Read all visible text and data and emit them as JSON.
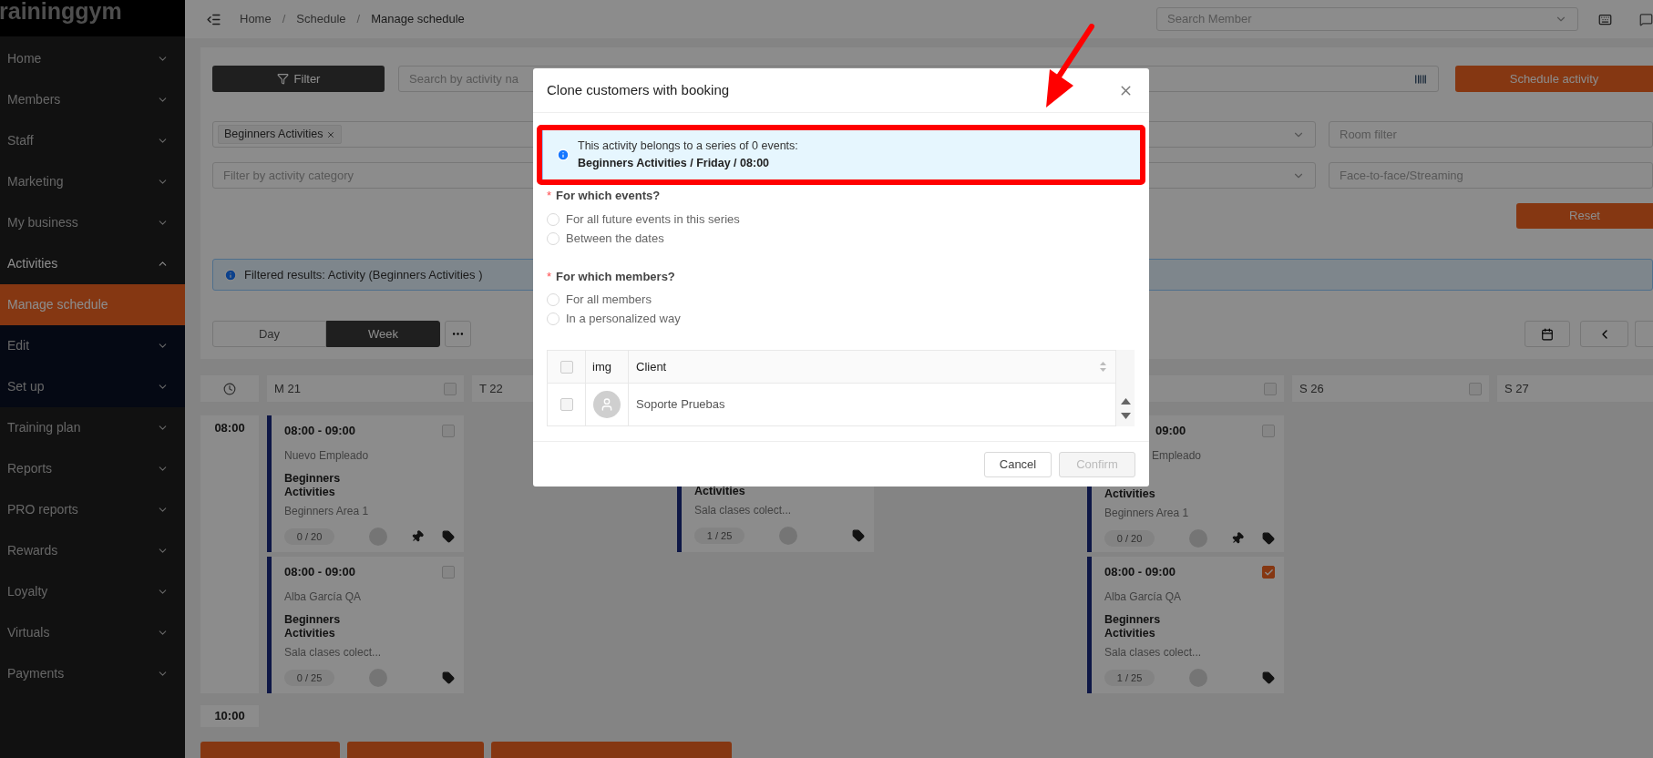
{
  "sidebar": {
    "logo": "raininggym",
    "items": [
      {
        "label": "Home",
        "selected": false,
        "expanded": false
      },
      {
        "label": "Members",
        "selected": false,
        "expanded": false
      },
      {
        "label": "Staff",
        "selected": false,
        "expanded": false
      },
      {
        "label": "Marketing",
        "selected": false,
        "expanded": false
      },
      {
        "label": "My business",
        "selected": false,
        "expanded": false
      },
      {
        "label": "Activities",
        "selected": false,
        "expanded": true,
        "children": [
          {
            "label": "Manage schedule",
            "selected": true
          },
          {
            "label": "Edit",
            "selected": false
          },
          {
            "label": "Set up",
            "selected": false
          }
        ]
      },
      {
        "label": "Training plan",
        "selected": false,
        "expanded": false
      },
      {
        "label": "Reports",
        "selected": false,
        "expanded": false
      },
      {
        "label": "PRO reports",
        "selected": false,
        "expanded": false
      },
      {
        "label": "Rewards",
        "selected": false,
        "expanded": false
      },
      {
        "label": "Loyalty",
        "selected": false,
        "expanded": false
      },
      {
        "label": "Virtuals",
        "selected": false,
        "expanded": false
      },
      {
        "label": "Payments",
        "selected": false,
        "expanded": false
      }
    ]
  },
  "breadcrumb": {
    "separator": "/",
    "items": [
      "Home",
      "Schedule",
      "Manage schedule"
    ]
  },
  "search_member": {
    "placeholder": "Search Member"
  },
  "filters": {
    "filter_button": "Filter",
    "search": {
      "placeholder": "Search by activity na"
    },
    "schedule_button": "Schedule activity",
    "activity_tags": [
      "Beginners Activities"
    ],
    "room": {
      "placeholder": "Room filter"
    },
    "category": {
      "placeholder": "Filter by activity category"
    },
    "mode": {
      "placeholder": "Face-to-face/Streaming"
    },
    "reset_button": "Reset"
  },
  "info_bar": "Filtered results: Activity (Beginners Activities )",
  "view_tabs": [
    {
      "label": "Day",
      "selected": false
    },
    {
      "label": "Week",
      "selected": true
    }
  ],
  "calendar": {
    "days": [
      {
        "kind": "day",
        "label": "M 21",
        "checked": false,
        "events": [
          {
            "kind": "full",
            "time": "08:00 - 09:00",
            "teacher": "Nuevo Empleado",
            "activity": "Beginners Activities",
            "room": "Beginners Area 1",
            "count": "0 / 20",
            "checked": false,
            "pinned": true
          },
          {
            "kind": "full",
            "time": "08:00 - 09:00",
            "teacher": "Alba García QA",
            "activity": "Beginners Activities",
            "room": "Sala clases colect...",
            "count": "0 / 25",
            "checked": false,
            "pinned": false
          }
        ]
      },
      {
        "kind": "day",
        "label": "T 22"
      },
      {
        "kind": "covered",
        "events": [
          {
            "kind": "cut_top",
            "activity": "Activities",
            "room": "Sala clases colect...",
            "count": "1 / 25",
            "pinned": false
          }
        ]
      },
      {
        "kind": "covered"
      },
      {
        "kind": "covered",
        "checked": false,
        "events": [
          {
            "kind": "cut_left",
            "time": "09:00",
            "teacher": "Empleado",
            "activity": "Activities",
            "room": "Beginners Area 1",
            "count": "0 / 20",
            "checked": false,
            "pinned": true
          },
          {
            "kind": "full",
            "time": "08:00 - 09:00",
            "teacher": "Alba García QA",
            "activity": "Beginners Activities",
            "room": "Sala clases colect...",
            "count": "1 / 25",
            "checked": true,
            "pinned": false
          }
        ]
      },
      {
        "kind": "day",
        "label": "S 26",
        "checked": false
      },
      {
        "kind": "day",
        "label": "S 27"
      }
    ],
    "hours": [
      "08:00",
      "10:00"
    ]
  },
  "modal": {
    "title": "Clone customers with booking",
    "info": {
      "text": "This activity belongs to a series of 0 events:",
      "detail": "Beginners Activities / Friday / 08:00"
    },
    "questions": [
      {
        "required_mark": "*",
        "label": "For which events?",
        "options": [
          {
            "label": "For all future events in this series",
            "selected": false
          },
          {
            "label": "Between the dates",
            "selected": false
          }
        ]
      },
      {
        "required_mark": "*",
        "label": "For which members?",
        "options": [
          {
            "label": "For all members",
            "selected": false
          },
          {
            "label": "In a personalized way",
            "selected": false
          }
        ]
      }
    ],
    "table": {
      "header_checked": false,
      "columns": [
        "img",
        "Client"
      ],
      "rows": [
        {
          "client": "Soporte Pruebas",
          "checked": false
        }
      ]
    },
    "buttons": [
      {
        "label": "Cancel",
        "disabled": false
      },
      {
        "label": "Confirm",
        "disabled": true
      }
    ]
  }
}
